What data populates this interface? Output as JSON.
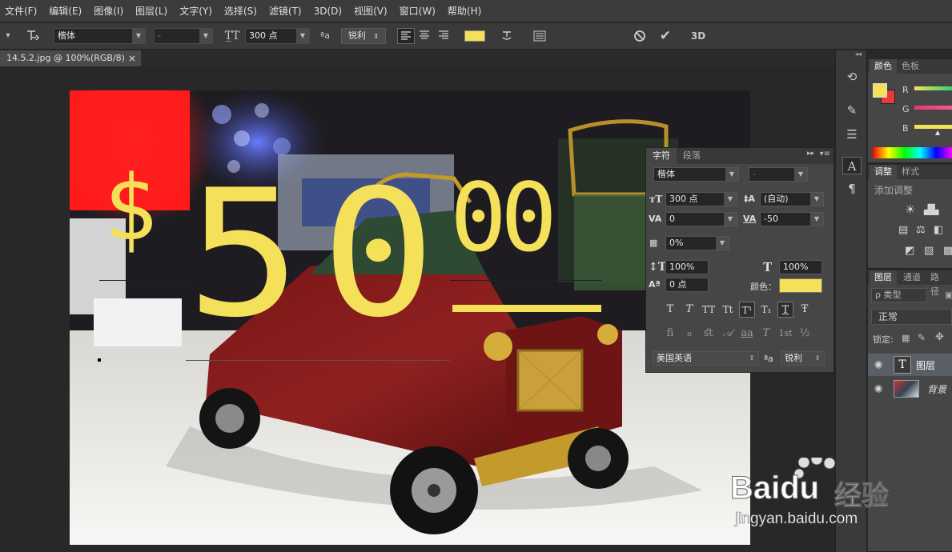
{
  "menu": [
    "文件(F)",
    "编辑(E)",
    "图像(I)",
    "图层(L)",
    "文字(Y)",
    "选择(S)",
    "滤镜(T)",
    "3D(D)",
    "视图(V)",
    "窗口(W)",
    "帮助(H)"
  ],
  "options": {
    "font_family": "楷体",
    "font_style": "-",
    "font_size": "300 点",
    "antialias_icon": "ªa",
    "antialias": "锐利",
    "color": "#f5e05a",
    "threed": "3D"
  },
  "document": {
    "tab_title": "14.5.2.jpg @ 100%(RGB/8)",
    "close": "×"
  },
  "canvas_text": {
    "dollar": "$",
    "five": "5",
    "zero": "0",
    "sup": "00",
    "text_color": "#f5e05a"
  },
  "character_panel": {
    "tab_char": "字符",
    "tab_para": "段落",
    "font_family": "楷体",
    "font_style": "-",
    "size": "300 点",
    "leading": "(自动)",
    "kerning": "0",
    "tracking": "-50",
    "scale": "0%",
    "vscale": "100%",
    "hscale": "100%",
    "baseline": "0 点",
    "color_label": "颜色：",
    "color": "#f5e05a",
    "type_buttons": [
      "T",
      "T",
      "TT",
      "Tt",
      "T¹",
      "T₁",
      "T",
      "Ŧ"
    ],
    "ot_buttons": [
      "ﬁ",
      "ℴ",
      "ﬆ",
      "𝒜",
      "aa",
      "T",
      "1st",
      "½"
    ],
    "language": "美国英语",
    "antialias_icon": "ªa",
    "antialias": "锐利"
  },
  "right_panels": {
    "color_tab": "颜色",
    "swatch_tab": "色板",
    "r": "R",
    "g": "G",
    "b": "B",
    "fg_color": "#f5e05a",
    "bg_color": "#e83a3a",
    "adjust_tab": "调整",
    "style_tab": "样式",
    "add_adjust": "添加调整",
    "layers_tab": "图层",
    "channels_tab": "通道",
    "paths_tab": "路径",
    "kind": "ρ 类型",
    "blend": "正常",
    "lock": "锁定:",
    "layers": [
      {
        "name": "图层",
        "type": "T"
      },
      {
        "name": "背景",
        "type": "img"
      }
    ]
  },
  "watermark": {
    "brand": "Baidu",
    "cn": "经验",
    "url": "jingyan.baidu.com"
  }
}
